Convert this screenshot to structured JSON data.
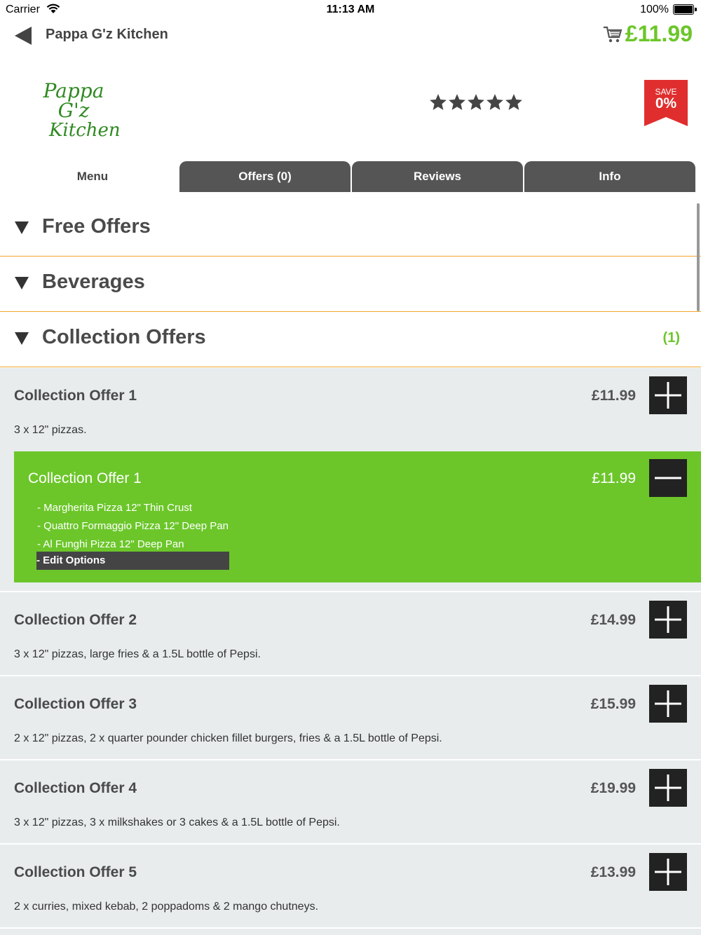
{
  "status_bar": {
    "carrier": "Carrier",
    "time": "11:13 AM",
    "battery": "100%"
  },
  "nav": {
    "title": "Pappa G'z Kitchen",
    "cart_total": "£11.99",
    "back_icon": "back-arrow-icon",
    "cart_icon": "cart-icon"
  },
  "header": {
    "logo_line1": "Pappa G'z",
    "logo_line2": "Kitchen",
    "rating_stars": 5,
    "save_label": "SAVE",
    "save_percent": "0%"
  },
  "tabs": [
    {
      "label": "Menu",
      "active": true
    },
    {
      "label": "Offers (0)",
      "active": false
    },
    {
      "label": "Reviews",
      "active": false
    },
    {
      "label": "Info",
      "active": false
    }
  ],
  "sections": [
    {
      "title": "Free Offers",
      "count": ""
    },
    {
      "title": "Beverages",
      "count": ""
    },
    {
      "title": "Collection Offers",
      "count": "(1)"
    }
  ],
  "offers": [
    {
      "name": "Collection Offer 1",
      "price": "£11.99",
      "description": "3 x 12\" pizzas."
    },
    {
      "name": "Collection Offer 2",
      "price": "£14.99",
      "description": "3 x 12\" pizzas, large fries & a 1.5L bottle of Pepsi."
    },
    {
      "name": "Collection Offer 3",
      "price": "£15.99",
      "description": "2 x 12\" pizzas, 2 x quarter pounder chicken fillet burgers, fries & a 1.5L bottle of Pepsi."
    },
    {
      "name": "Collection Offer 4",
      "price": "£19.99",
      "description": "3 x 12\" pizzas, 3 x milkshakes or 3 cakes & a 1.5L bottle of Pepsi."
    },
    {
      "name": "Collection Offer 5",
      "price": "£13.99",
      "description": "2 x curries, mixed kebab, 2 poppadoms & 2 mango chutneys."
    }
  ],
  "basket_item": {
    "name": "Collection Offer 1",
    "price": "£11.99",
    "items": [
      "- Margherita Pizza 12\" Thin Crust",
      "- Quattro Formaggio Pizza 12\" Deep Pan",
      "- Al Funghi Pizza 12\" Deep Pan"
    ],
    "edit_label": "- Edit Options"
  },
  "colors": {
    "accent_green": "#6cc62a",
    "divider_orange": "#f0a52b",
    "tab_dark": "#555555",
    "badge_red": "#e02e2e"
  }
}
